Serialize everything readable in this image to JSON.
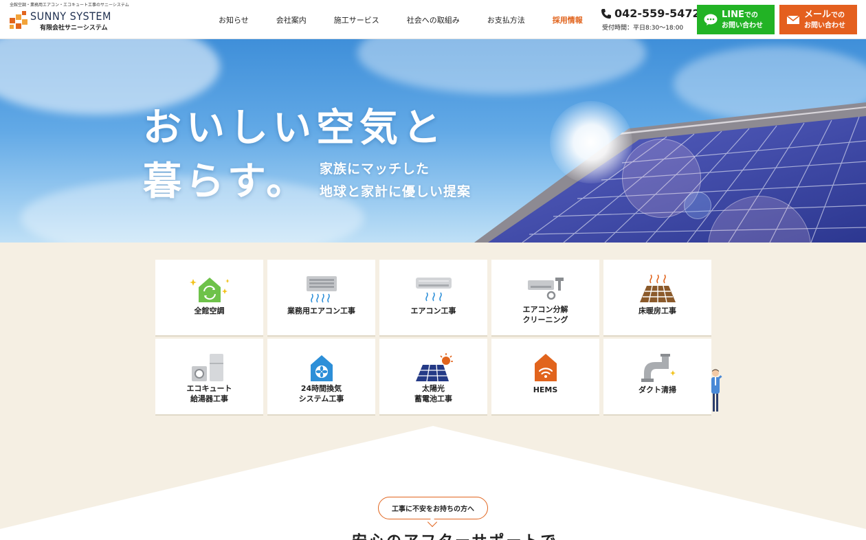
{
  "header": {
    "tagline": "全館空調・業務用エアコン・エコキュート工事のサニーシステム",
    "logo_name": "SUNNY SYSTEM",
    "logo_sub": "有限会社サニーシステム",
    "nav": [
      {
        "label": "お知らせ"
      },
      {
        "label": "会社案内"
      },
      {
        "label": "施工サービス"
      },
      {
        "label": "社会への取組み"
      },
      {
        "label": "お支払方法"
      },
      {
        "label": "採用情報"
      }
    ],
    "phone_number": "042-559-5472",
    "phone_hours": "受付時間：平日8:30〜18:00",
    "line_cta": {
      "line1_big": "LINE",
      "line1_small": "での",
      "line2": "お問い合わせ"
    },
    "mail_cta": {
      "line1_big": "メール",
      "line1_small": "での",
      "line2": "お問い合わせ"
    }
  },
  "hero": {
    "title_line1": "おいしい空気と",
    "title_line2": "暮らす。",
    "sub_line1": "家族にマッチした",
    "sub_line2": "地球と家計に優しい提案"
  },
  "services": [
    {
      "label1": "全館空調",
      "label2": "",
      "icon": "house-airflow-icon"
    },
    {
      "label1": "業務用エアコン工事",
      "label2": "",
      "icon": "commercial-aircon-icon"
    },
    {
      "label1": "エアコン工事",
      "label2": "",
      "icon": "aircon-icon"
    },
    {
      "label1": "エアコン分解",
      "label2": "クリーニング",
      "icon": "aircon-cleaning-icon"
    },
    {
      "label1": "床暖房工事",
      "label2": "",
      "icon": "floor-heating-icon"
    },
    {
      "label1": "エコキュート",
      "label2": "給湯器工事",
      "icon": "water-heater-icon"
    },
    {
      "label1": "24時間換気",
      "label2": "システム工事",
      "icon": "ventilation-house-icon"
    },
    {
      "label1": "太陽光",
      "label2": "蓄電池工事",
      "icon": "solar-panel-icon"
    },
    {
      "label1": "HEMS",
      "label2": "",
      "icon": "hems-wifi-house-icon"
    },
    {
      "label1": "ダクト清掃",
      "label2": "",
      "icon": "duct-icon"
    }
  ],
  "bottom": {
    "pill_text": "工事に不安をお持ちの方へ",
    "heading_partial": "安心のアフターサポートで"
  },
  "colors": {
    "accent_orange": "#e1641d",
    "line_green": "#22b325",
    "mail_orange": "#e45f1e",
    "beige_bg": "#f5efe3"
  }
}
